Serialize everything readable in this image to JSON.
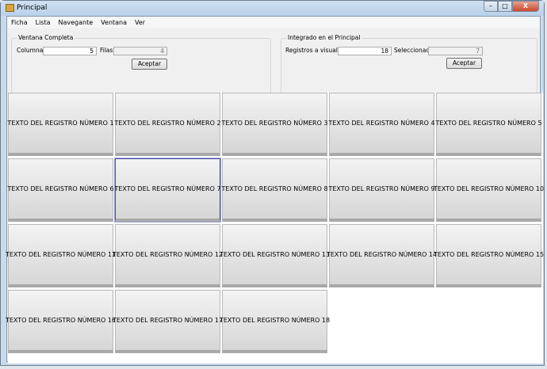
{
  "window": {
    "title": "Principal",
    "controls": {
      "minimize": "–",
      "maximize": "□",
      "close": "X"
    }
  },
  "menu": [
    "Ficha",
    "Lista",
    "Navegante",
    "Ventana",
    "Ver"
  ],
  "ventana_completa": {
    "legend": "Ventana Completa",
    "columnas_label": "Columnas",
    "columnas_value": "5",
    "filas_label": "Filas",
    "filas_value": "4",
    "accept": "Aceptar"
  },
  "integrado": {
    "legend": "Integrado en el Principal",
    "registros_label": "Registros a visualizar",
    "registros_value": "18",
    "seleccionado_label": "Seleccionado",
    "seleccionado_value": "7",
    "accept": "Aceptar"
  },
  "records": [
    "TEXTO DEL REGISTRO NÚMERO 1",
    "TEXTO DEL REGISTRO NÚMERO 2",
    "TEXTO DEL REGISTRO NÚMERO 3",
    "TEXTO DEL REGISTRO NÚMERO 4",
    "TEXTO DEL REGISTRO NÚMERO 5",
    "TEXTO DEL REGISTRO NÚMERO 6",
    "TEXTO DEL REGISTRO NÚMERO 7",
    "TEXTO DEL REGISTRO NÚMERO 8",
    "TEXTO DEL REGISTRO NÚMERO 9",
    "TEXTO DEL REGISTRO NÚMERO 10",
    "TEXTO DEL REGISTRO NÚMERO 11",
    "TEXTO DEL REGISTRO NÚMERO 12",
    "TEXTO DEL REGISTRO NÚMERO 13",
    "TEXTO DEL REGISTRO NÚMERO 14",
    "TEXTO DEL REGISTRO NÚMERO 15",
    "TEXTO DEL REGISTRO NÚMERO 16",
    "TEXTO DEL REGISTRO NÚMERO 17",
    "TEXTO DEL REGISTRO NÚMERO 18"
  ],
  "selected_index": 6
}
